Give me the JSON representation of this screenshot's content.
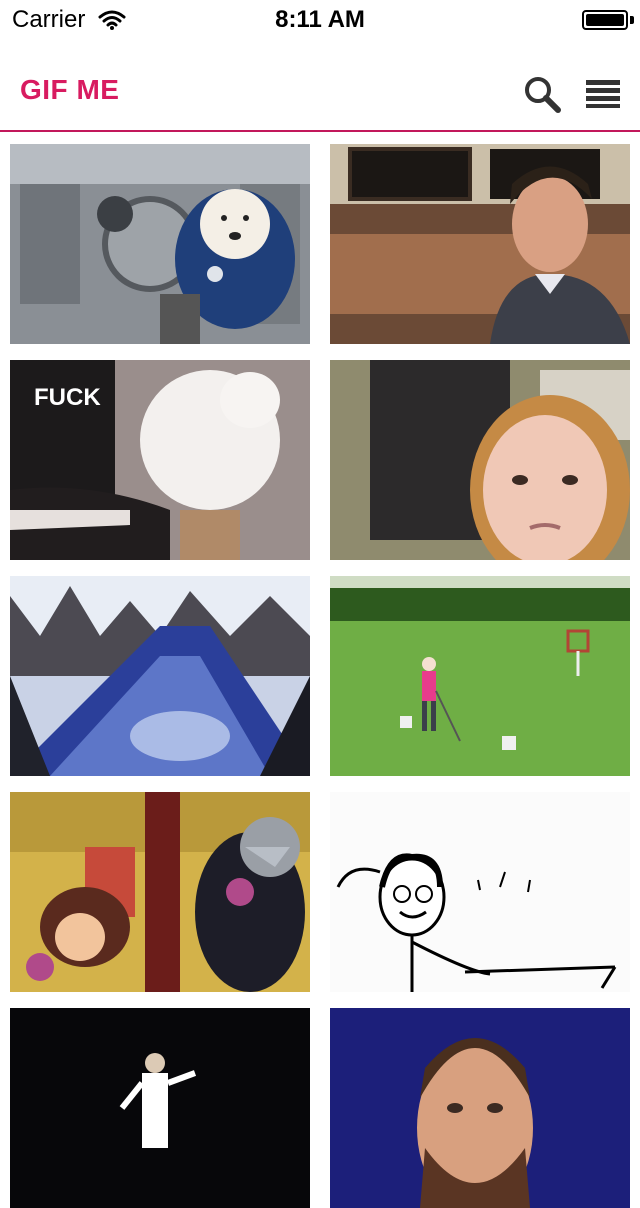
{
  "status_bar": {
    "carrier": "Carrier",
    "time": "8:11 AM",
    "battery_level": 1.0
  },
  "header": {
    "title": "GIF ME",
    "accent_color": "#d81b60"
  },
  "icons": {
    "search": "search-icon",
    "menu": "menu-icon",
    "wifi": "wifi-icon",
    "battery": "battery-icon"
  },
  "gifs": [
    {
      "name": "gif-dog-astronaut"
    },
    {
      "name": "gif-man-looking-down",
      "caption": ""
    },
    {
      "name": "gif-cat-punching",
      "caption": "FUCK"
    },
    {
      "name": "gif-girl-with-cat",
      "caption": ""
    },
    {
      "name": "gif-water-slide",
      "caption": ""
    },
    {
      "name": "gif-golfer",
      "caption": ""
    },
    {
      "name": "gif-cartoon-room",
      "caption": ""
    },
    {
      "name": "gif-stick-figure-drawing",
      "caption": ""
    },
    {
      "name": "gif-dancing-man",
      "caption": ""
    },
    {
      "name": "gif-bearded-man",
      "caption": ""
    }
  ]
}
